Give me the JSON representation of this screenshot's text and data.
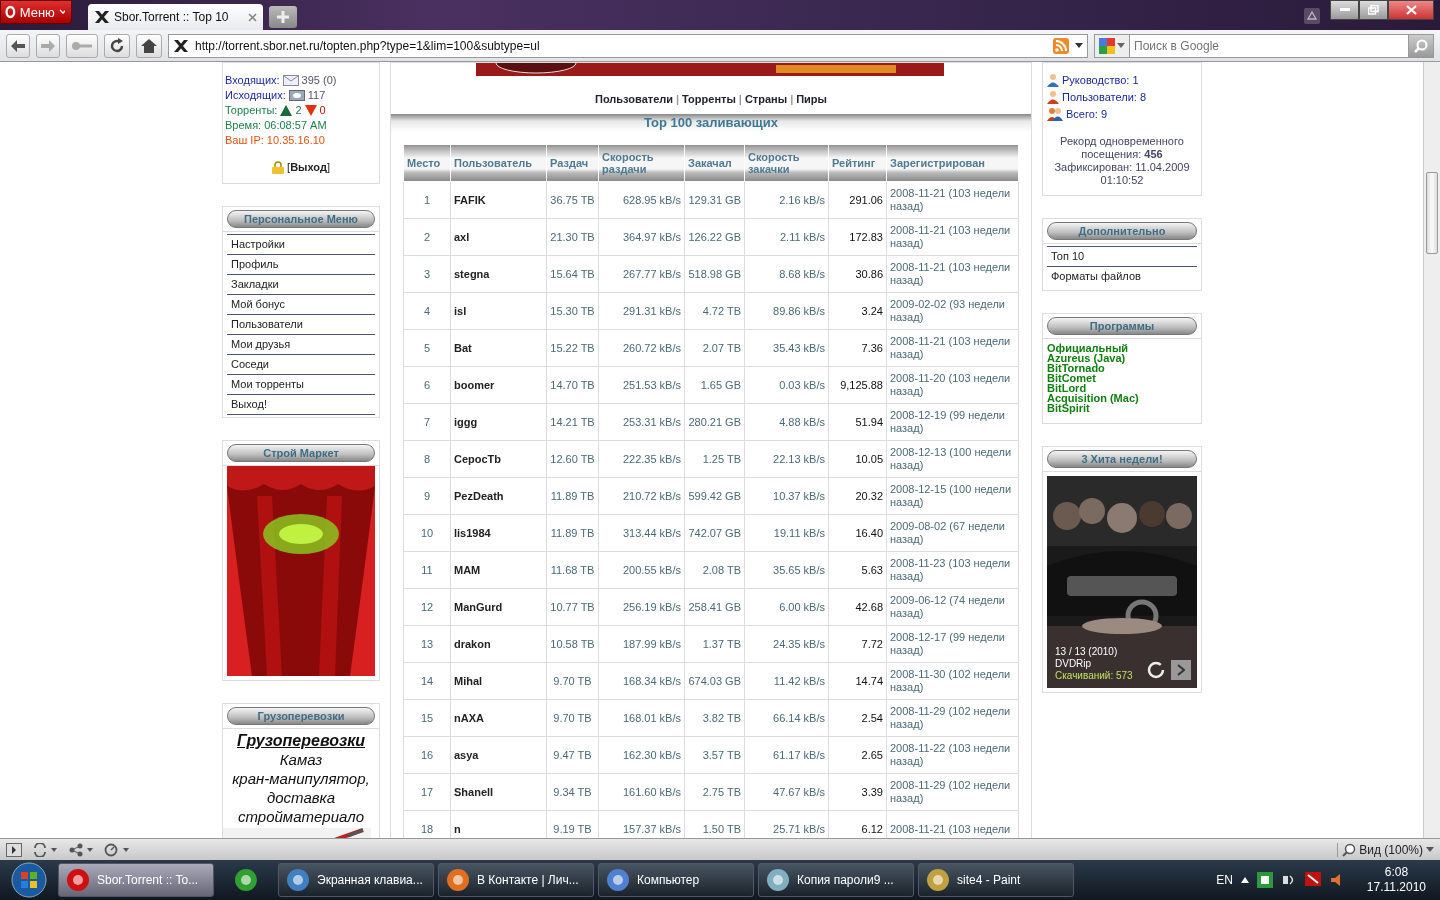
{
  "browser": {
    "menu_label": "Меню",
    "tabs": [
      {
        "title": "Sbor.Torrent :: Top 10",
        "selected": true
      }
    ],
    "address": {
      "url": "http://torrent.sbor.net.ru/topten.php?type=1&lim=100&subtype=ul"
    },
    "search": {
      "placeholder": "Поиск в Google"
    }
  },
  "left": {
    "incoming": {
      "label": "Входящих:",
      "value": "395 (0)"
    },
    "outgoing": {
      "label": "Исходящих:",
      "value": "117"
    },
    "torrents": {
      "label": "Торренты:",
      "seeding": "2",
      "leeching": "0"
    },
    "time": "Время: 06:08:57 AM",
    "ip": "Ваш IP: 10.35.16.10",
    "logout": "[**Выход**]",
    "menu": {
      "title": "Персональное Меню",
      "items": [
        "Настройки",
        "Профиль",
        "Закладки",
        "Мой бонус",
        "Пользователи",
        "Мои друзья",
        "Соседи",
        "Мои торренты",
        "Выход!"
      ]
    },
    "market": {
      "title": "Строй Маркет"
    },
    "cargo": {
      "title": "Грузоперевозки",
      "heading": "Грузоперевозки",
      "lines": [
        "Камаз",
        "кран-манипулятор,",
        "доставка",
        "стройматериало"
      ]
    }
  },
  "center": {
    "links": [
      {
        "kind": "link",
        "text": "Пользователи"
      },
      {
        "kind": "separator",
        "text": "|"
      },
      {
        "kind": "link",
        "text": "Торренты"
      },
      {
        "kind": "separator",
        "text": "|"
      },
      {
        "kind": "link",
        "text": "Страны"
      },
      {
        "kind": "separator",
        "text": "|"
      },
      {
        "kind": "link",
        "text": "Пиры"
      }
    ],
    "title": "Top 100 заливающих",
    "table": {
      "columns": [
        "Место",
        "Пользователь",
        "Раздач",
        "Скорость раздачи",
        "Закачал",
        "Скорость закачки",
        "Рейтинг",
        "Зарегистрирован"
      ],
      "rows": [
        [
          "1",
          "FAFIK",
          "36.75 TB",
          "628.95 kB/s",
          "129.31 GB",
          "2.16 kB/s",
          "291.06",
          "2008-11-21 (103 недели назад)"
        ],
        [
          "2",
          "axl",
          "21.30 TB",
          "364.97 kB/s",
          "126.22 GB",
          "2.11 kB/s",
          "172.83",
          "2008-11-21 (103 недели назад)"
        ],
        [
          "3",
          "stegna",
          "15.64 TB",
          "267.77 kB/s",
          "518.98 GB",
          "8.68 kB/s",
          "30.86",
          "2008-11-21 (103 недели назад)"
        ],
        [
          "4",
          "isl",
          "15.30 TB",
          "291.31 kB/s",
          "4.72 TB",
          "89.86 kB/s",
          "3.24",
          "2009-02-02 (93 недели назад)"
        ],
        [
          "5",
          "Bat",
          "15.22 TB",
          "260.72 kB/s",
          "2.07 TB",
          "35.43 kB/s",
          "7.36",
          "2008-11-21 (103 недели назад)"
        ],
        [
          "6",
          "boomer",
          "14.70 TB",
          "251.53 kB/s",
          "1.65 GB",
          "0.03 kB/s",
          "9,125.88",
          "2008-11-20 (103 недели назад)"
        ],
        [
          "7",
          "iggg",
          "14.21 TB",
          "253.31 kB/s",
          "280.21 GB",
          "4.88 kB/s",
          "51.94",
          "2008-12-19 (99 недели назад)"
        ],
        [
          "8",
          "CepocTb",
          "12.60 TB",
          "222.35 kB/s",
          "1.25 TB",
          "22.13 kB/s",
          "10.05",
          "2008-12-13 (100 недели назад)"
        ],
        [
          "9",
          "PezDeath",
          "11.89 TB",
          "210.72 kB/s",
          "599.42 GB",
          "10.37 kB/s",
          "20.32",
          "2008-12-15 (100 недели назад)"
        ],
        [
          "10",
          "lis1984",
          "11.89 TB",
          "313.44 kB/s",
          "742.07 GB",
          "19.11 kB/s",
          "16.40",
          "2009-08-02 (67 недели назад)"
        ],
        [
          "11",
          "MAM",
          "11.68 TB",
          "200.55 kB/s",
          "2.08 TB",
          "35.65 kB/s",
          "5.63",
          "2008-11-23 (103 недели назад)"
        ],
        [
          "12",
          "ManGurd",
          "10.77 TB",
          "256.19 kB/s",
          "258.41 GB",
          "6.00 kB/s",
          "42.68",
          "2009-06-12 (74 недели назад)"
        ],
        [
          "13",
          "drakon",
          "10.58 TB",
          "187.99 kB/s",
          "1.37 TB",
          "24.35 kB/s",
          "7.72",
          "2008-12-17 (99 недели назад)"
        ],
        [
          "14",
          "Mihal",
          "9.70 TB",
          "168.34 kB/s",
          "674.03 GB",
          "11.42 kB/s",
          "14.74",
          "2008-11-30 (102 недели назад)"
        ],
        [
          "15",
          "nAXA",
          "9.70 TB",
          "168.01 kB/s",
          "3.82 TB",
          "66.14 kB/s",
          "2.54",
          "2008-11-29 (102 недели назад)"
        ],
        [
          "16",
          "asya",
          "9.47 TB",
          "162.30 kB/s",
          "3.57 TB",
          "61.17 kB/s",
          "2.65",
          "2008-11-22 (103 недели назад)"
        ],
        [
          "17",
          "Shanell",
          "9.34 TB",
          "161.60 kB/s",
          "2.75 TB",
          "47.67 kB/s",
          "3.39",
          "2008-11-29 (102 недели назад)"
        ],
        [
          "18",
          "n",
          "9.19 TB",
          "157.37 kB/s",
          "1.50 TB",
          "25.71 kB/s",
          "6.12",
          "2008-11-21 (103 недели"
        ]
      ]
    }
  },
  "right": {
    "online": [
      {
        "kind": "staff",
        "text": "Руководство: 1"
      },
      {
        "kind": "user",
        "text": "Пользователи: 8"
      },
      {
        "kind": "all",
        "text": "Всего: 9"
      }
    ],
    "record": "Рекорд одновременного посещения: **456** Зафиксирован: 11.04.2009 01:10:52",
    "extra": {
      "title": "Дополнительно",
      "items": [
        "Топ 10",
        "Форматы файлов"
      ]
    },
    "programs": {
      "title": "Программы",
      "items": [
        "Официальный",
        "Azureus (Java)",
        "BitTornado",
        "BitComet",
        "BitLord",
        "Acquisition (Mac)",
        "BitSpirit"
      ]
    },
    "hits": {
      "title": "3 Хита недели!",
      "caption": "13 / 13 (2010)",
      "quality": "DVDRip",
      "downloads": "Скачиваний: 573"
    }
  },
  "status_bar": {
    "zoom": "Вид (100%)"
  },
  "taskbar": {
    "items": [
      {
        "kind": "window",
        "label": "Sbor.Torrent :: To...",
        "color": "#d01010",
        "selected": true
      },
      {
        "kind": "pinned",
        "color": "#30a030",
        "selected": false
      },
      {
        "kind": "window",
        "label": "Экранная клавиа...",
        "color": "#4080c0",
        "selected": false
      },
      {
        "kind": "window",
        "label": "В Контакте | Лич...",
        "color": "#e07020",
        "selected": false
      },
      {
        "kind": "window",
        "label": "Компьютер",
        "color": "#5080d0",
        "selected": false
      },
      {
        "kind": "window",
        "label": "Копия пароли9 ...",
        "color": "#80b0c0",
        "selected": false
      },
      {
        "kind": "window",
        "label": "site4 - Paint",
        "color": "#c0a040",
        "selected": false
      }
    ],
    "lang": "EN",
    "time": "6:08",
    "date": "17.11.2010"
  }
}
